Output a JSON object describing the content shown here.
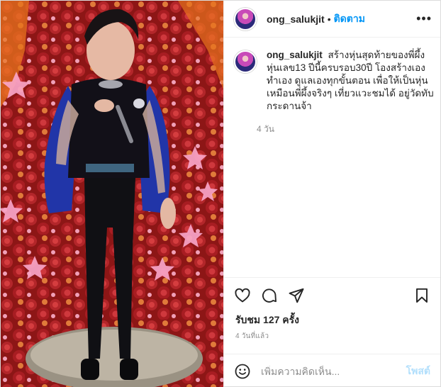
{
  "colors": {
    "accent": "#0095f6",
    "text": "#262626",
    "muted": "#8e8e8e",
    "post_disabled": "#b2dffc"
  },
  "header": {
    "username": "ong_salukjit",
    "separator": "•",
    "follow_label": "ติดตาม",
    "more_icon": "more-horizontal-icon"
  },
  "caption": {
    "username": "ong_salukjit",
    "text": "สร้างหุ่นสุดท้ายของพี่ผึ้ง หุ่นเลข13 ปีนี้ครบรอบ30ปี โองสร้างเอง ทำเอง ดูแลเองทุกขั้นตอน เพื่อให้เป็นหุ่นเหมือนพี่ผึ้งจริงๆ เที่ยวแวะชมได้ อยู่วัดทับกระดานจ้า",
    "time": "4 วัน"
  },
  "actions": {
    "like_icon": "heart-icon",
    "comment_icon": "comment-icon",
    "share_icon": "paper-plane-icon",
    "save_icon": "bookmark-icon"
  },
  "stats": {
    "views": "รับชม 127 ครั้ง",
    "posted": "4 วันที่แล้ว"
  },
  "comment_box": {
    "emoji_icon": "smiley-icon",
    "placeholder": "เพิ่มความคิดเห็น...",
    "post_label": "โพสต์"
  }
}
